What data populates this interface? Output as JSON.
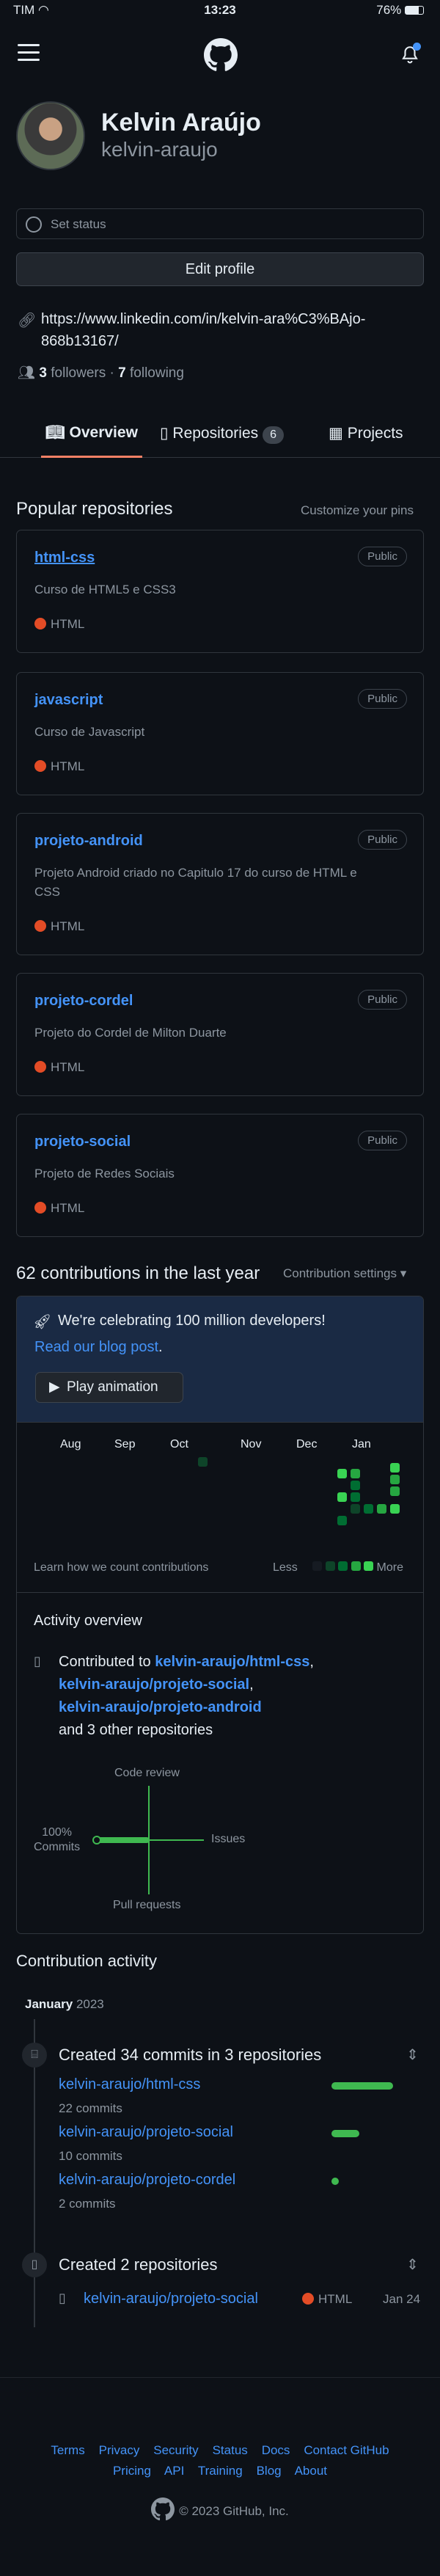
{
  "status_bar": {
    "carrier": "TIM",
    "time": "13:23",
    "battery": "76%"
  },
  "profile": {
    "name": "Kelvin Araújo",
    "login": "kelvin-araujo",
    "set_status": "Set status",
    "edit_profile": "Edit profile",
    "link_line1": "https://www.linkedin.com/in/kelvin-ara%C3%BAjo-",
    "link_line2": "868b13167/",
    "followers_count": "3",
    "followers_label": "followers",
    "separator": "·",
    "following_count": "7",
    "following_label": "following"
  },
  "tabs": [
    {
      "label": "Overview"
    },
    {
      "label": "Repositories",
      "count": "6"
    },
    {
      "label": "Projects"
    }
  ],
  "popular": {
    "title": "Popular repositories",
    "customize": "Customize your pins",
    "repos": [
      {
        "name": "html-css",
        "visibility": "Public",
        "desc": "Curso de HTML5 e CSS3",
        "lang": "HTML"
      },
      {
        "name": "javascript",
        "visibility": "Public",
        "desc": "Curso de Javascript",
        "lang": "HTML"
      },
      {
        "name": "projeto-android",
        "visibility": "Public",
        "desc": "Projeto Android criado no Capitulo 17 do curso de HTML e CSS",
        "lang": "HTML"
      },
      {
        "name": "projeto-cordel",
        "visibility": "Public",
        "desc": "Projeto do Cordel de Milton Duarte",
        "lang": "HTML"
      },
      {
        "name": "projeto-social",
        "visibility": "Public",
        "desc": "Projeto de Redes Sociais",
        "lang": "HTML"
      }
    ]
  },
  "contributions": {
    "title": "62 contributions in the last year",
    "settings": "Contribution settings",
    "banner_text": "We're celebrating 100 million developers!",
    "banner_link": "Read our blog post",
    "banner_period": ".",
    "play": "Play animation",
    "months": [
      "Aug",
      "Sep",
      "Oct",
      "Nov",
      "Dec",
      "Jan"
    ],
    "learn": "Learn how we count contributions",
    "less": "Less",
    "more": "More"
  },
  "activity_overview": {
    "title": "Activity overview",
    "contributed_to": "Contributed to",
    "repo1": "kelvin-araujo/html-css",
    "comma1": ",",
    "repo2": "kelvin-araujo/projeto-social",
    "comma2": ",",
    "repo3": "kelvin-araujo/projeto-android",
    "others": "and 3 other repositories",
    "code_review": "Code review",
    "issues": "Issues",
    "pull_requests": "Pull requests",
    "commits_pct": "100%",
    "commits_label": "Commits"
  },
  "activity": {
    "title": "Contribution activity",
    "month": "January",
    "year": "2023",
    "commits_title": "Created 34 commits in 3 repositories",
    "commit_repos": [
      {
        "name": "kelvin-araujo/html-css",
        "count": "22 commits",
        "share": 0.65
      },
      {
        "name": "kelvin-araujo/projeto-social",
        "count": "10 commits",
        "share": 0.29
      },
      {
        "name": "kelvin-araujo/projeto-cordel",
        "count": "2 commits",
        "share": 0.06
      }
    ],
    "repos_title": "Created 2 repositories",
    "created_repo": {
      "name": "kelvin-araujo/projeto-social",
      "lang": "HTML",
      "date": "Jan 24"
    }
  },
  "footer": {
    "links_row1": [
      "Terms",
      "Privacy",
      "Security",
      "Status",
      "Docs",
      "Contact GitHub"
    ],
    "links_row2": [
      "Pricing",
      "API",
      "Training",
      "Blog",
      "About"
    ],
    "copyright": "© 2023 GitHub, Inc."
  },
  "colors": {
    "accent": "#4493f8",
    "html_lang": "#e34c26",
    "tab_underline": "#f78166",
    "green": "#3fb950"
  }
}
